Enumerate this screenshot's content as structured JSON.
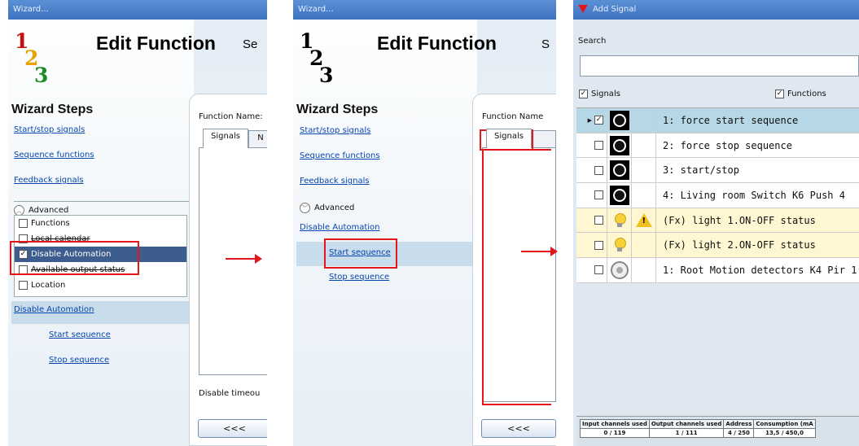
{
  "panel1": {
    "title": "Wizard...",
    "edit_title": "Edit Function",
    "edit_cut": "Se",
    "wizard_steps": "Wizard Steps",
    "links": [
      "Start/stop signals",
      "Sequence functions",
      "Feedback signals"
    ],
    "advanced": "Advanced",
    "checklist": [
      {
        "label": "Functions",
        "checked": false
      },
      {
        "label": "Local calendar",
        "checked": false
      },
      {
        "label": "Disable Automation",
        "checked": true
      },
      {
        "label": "Available output status",
        "checked": false
      },
      {
        "label": "Location",
        "checked": false
      }
    ],
    "disable_automation": "Disable Automation",
    "start_sequence": "Start sequence",
    "stop_sequence": "Stop sequence",
    "function_name": "Function Name:",
    "tab_signals": "Signals",
    "tab_next": "N",
    "disable_timeout": "Disable timeou",
    "back": "<<<"
  },
  "panel2": {
    "title": "Wizard...",
    "edit_title": "Edit Function",
    "edit_cut": "S",
    "wizard_steps": "Wizard Steps",
    "links": [
      "Start/stop signals",
      "Sequence functions",
      "Feedback signals"
    ],
    "advanced": "Advanced",
    "disable_automation": "Disable Automation",
    "start_sequence": "Start sequence",
    "stop_sequence": "Stop sequence",
    "function_name": "Function Name",
    "tab_signals": "Signals",
    "back": "<<<"
  },
  "panel3": {
    "title": "Add Signal",
    "search_label": "Search",
    "search_value": "",
    "signals_cb": "Signals",
    "functions_cb": "Functions",
    "rows": [
      {
        "name": "1: force start sequence",
        "checked": true,
        "icon": "black-signal-icon",
        "warn": false,
        "selected": true
      },
      {
        "name": "2: force stop sequence",
        "checked": false,
        "icon": "black-signal-icon",
        "warn": false,
        "selected": false
      },
      {
        "name": "3: start/stop",
        "checked": false,
        "icon": "black-signal-icon",
        "warn": false,
        "selected": false
      },
      {
        "name": "4: Living room Switch K6 Push 4",
        "checked": false,
        "icon": "black-signal-icon",
        "warn": false,
        "selected": false
      },
      {
        "name": "(Fx) light 1.ON-OFF status",
        "checked": false,
        "icon": "bulb-icon",
        "warn": true,
        "selected": false
      },
      {
        "name": "(Fx) light 2.ON-OFF status",
        "checked": false,
        "icon": "bulb-icon",
        "warn": false,
        "selected": false
      },
      {
        "name": "1: Root Motion detectors K4 Pir 1",
        "checked": false,
        "icon": "motion-detector-icon",
        "warn": false,
        "selected": false
      }
    ],
    "footer_headers": [
      "Input channels used",
      "Output channels used",
      "Address",
      "Consumption (mA"
    ],
    "footer_values": [
      "0 / 119",
      "1 / 111",
      "4 / 250",
      "13,5 / 450,0"
    ]
  },
  "colors": {
    "accent": "#3e5d8f",
    "red": "#e3161b"
  }
}
